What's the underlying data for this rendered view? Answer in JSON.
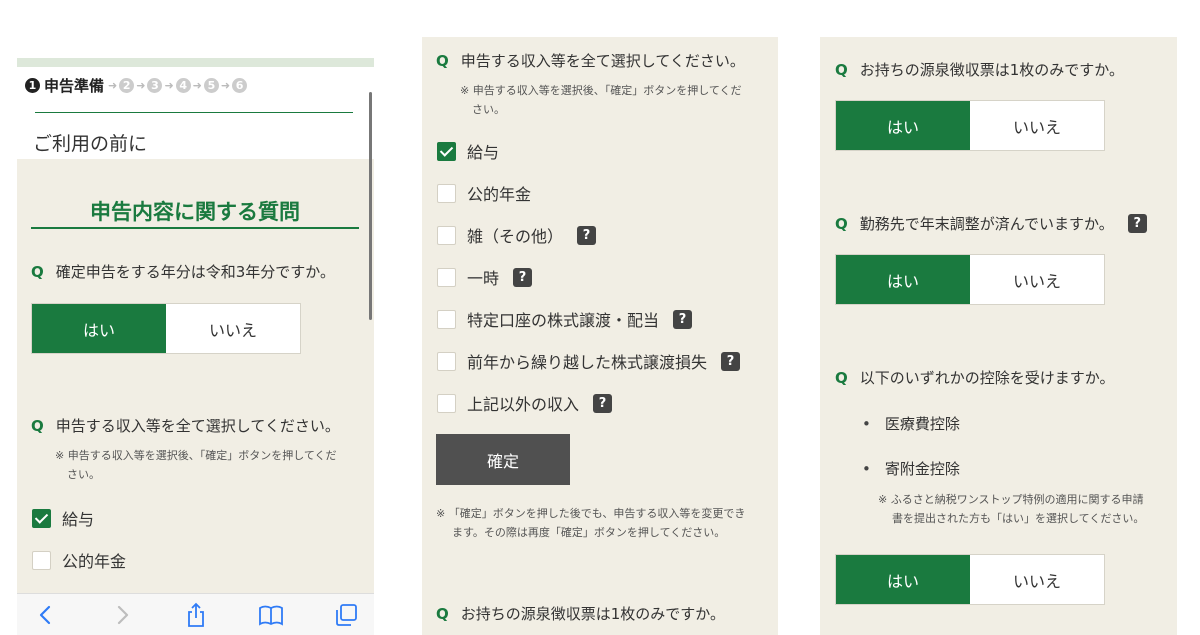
{
  "panel1": {
    "steps": {
      "step1_num": "1",
      "step1_label": "申告準備",
      "others": [
        "2",
        "3",
        "4",
        "5",
        "6"
      ]
    },
    "header_title": "ご利用の前に",
    "section_title": "申告内容に関する質問",
    "q_mark": "Q",
    "q1": "確定申告をする年分は令和3年分ですか。",
    "yes": "はい",
    "no": "いいえ",
    "q2": "申告する収入等を全て選択してください。",
    "note_line1": "※ 申告する収入等を選択後、「確定」ボタンを押してくだ",
    "note_line2": "さい。",
    "cb1": "給与",
    "cb2": "公的年金",
    "toolbar_icons": [
      "back-icon",
      "forward-icon",
      "share-icon",
      "bookmarks-icon",
      "tabs-icon"
    ]
  },
  "panel2": {
    "q_mark": "Q",
    "q": "申告する収入等を全て選択してください。",
    "note_line1": "※ 申告する収入等を選択後、「確定」ボタンを押してくだ",
    "note_line2": "さい。",
    "options": [
      {
        "label": "給与",
        "checked": true,
        "help": false
      },
      {
        "label": "公的年金",
        "checked": false,
        "help": false
      },
      {
        "label": "雑（その他）",
        "checked": false,
        "help": true
      },
      {
        "label": "一時",
        "checked": false,
        "help": true
      },
      {
        "label": "特定口座の株式譲渡・配当",
        "checked": false,
        "help": true
      },
      {
        "label": "前年から繰り越した株式譲渡損失",
        "checked": false,
        "help": true
      },
      {
        "label": "上記以外の収入",
        "checked": false,
        "help": true
      }
    ],
    "help_glyph": "?",
    "confirm": "確定",
    "bottom_note_line1": "※ 「確定」ボタンを押した後でも、申告する収入等を変更でき",
    "bottom_note_line2": "ます。その際は再度「確定」ボタンを押してください。",
    "q_next": "お持ちの源泉徴収票は1枚のみですか。"
  },
  "panel3": {
    "q_mark": "Q",
    "q1": "お持ちの源泉徴収票は1枚のみですか。",
    "q2": "勤務先で年末調整が済んでいますか。",
    "q3": "以下のいずれかの控除を受けますか。",
    "bullet1": "医療費控除",
    "bullet2": "寄附金控除",
    "note_line1": "※ ふるさと納税ワンストップ特例の適用に関する申請",
    "note_line2": "書を提出された方も「はい」を選択してください。",
    "yes": "はい",
    "no": "いいえ",
    "help_glyph": "?"
  },
  "colors": {
    "accent": "#1a7a3f",
    "background": "#f1eee4",
    "confirm_button": "#505050"
  }
}
